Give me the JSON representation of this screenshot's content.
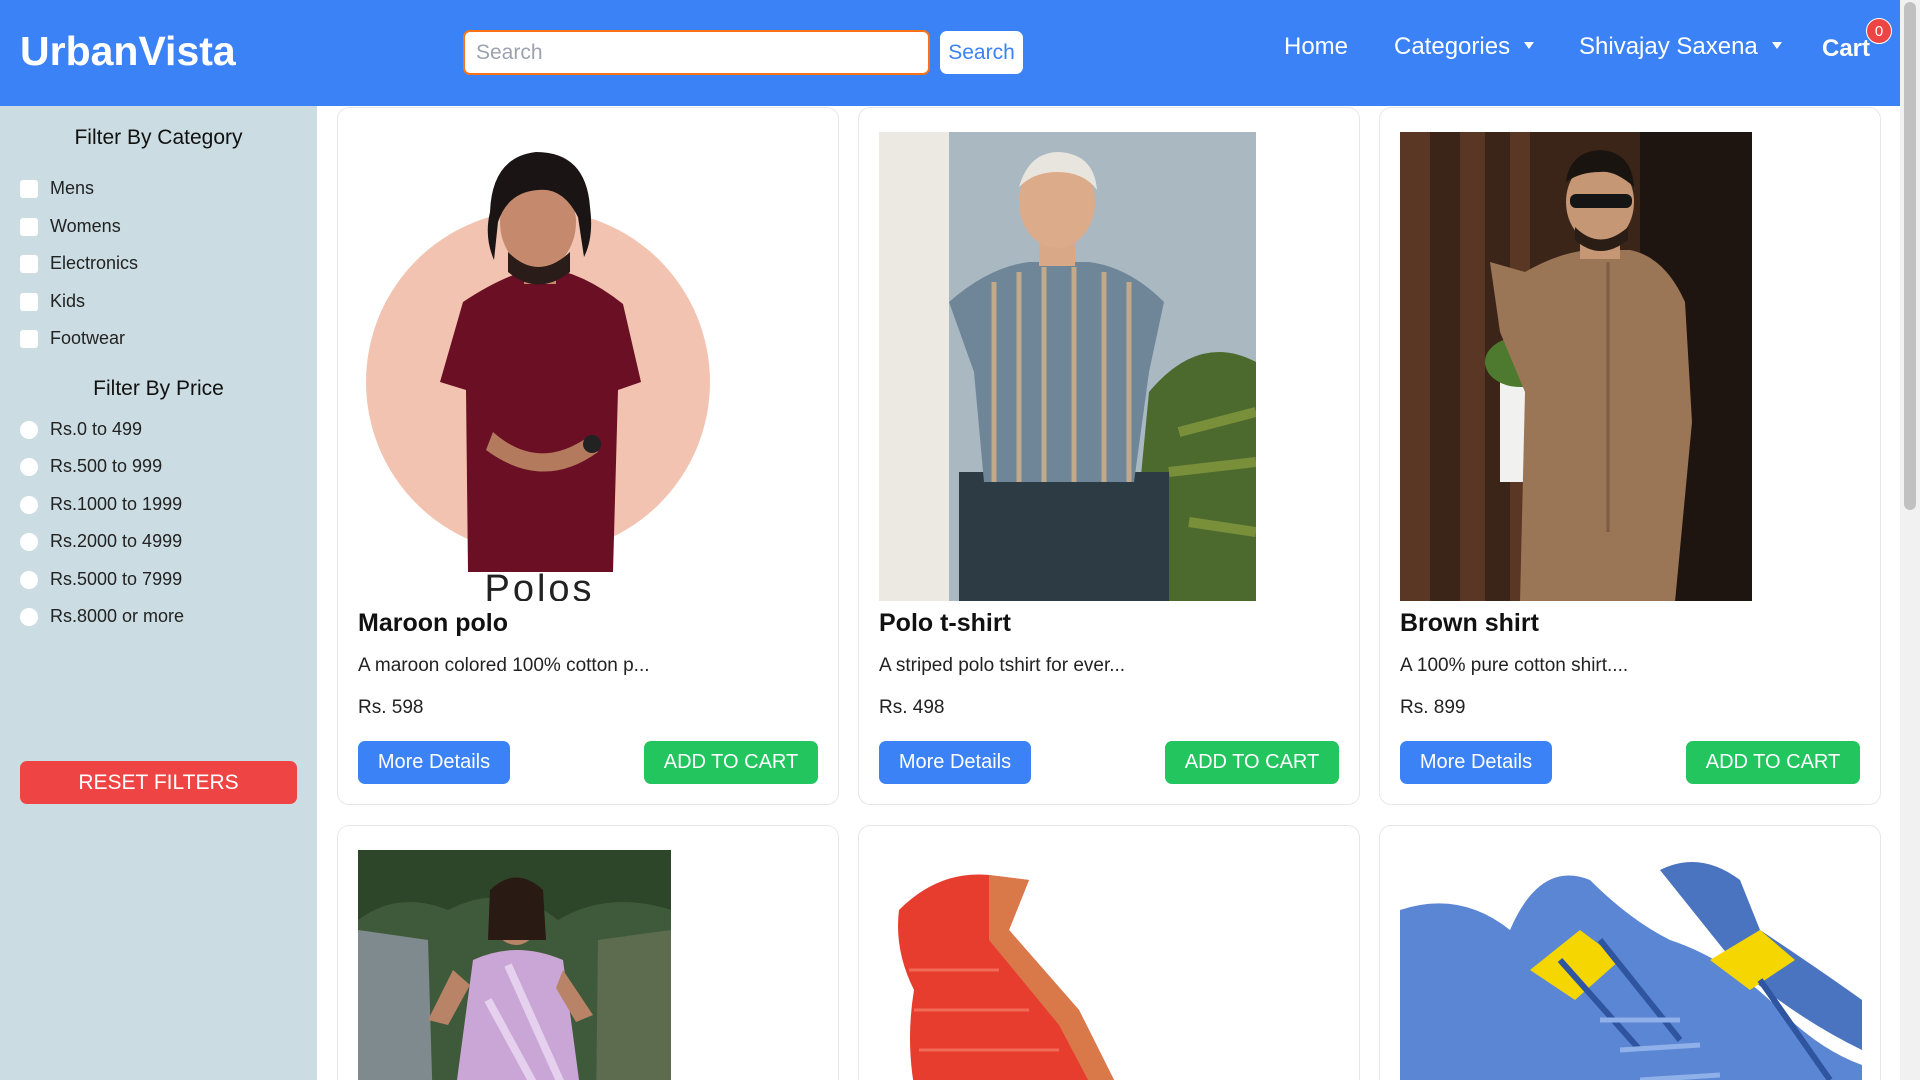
{
  "header": {
    "logo": "UrbanVista",
    "search_placeholder": "Search",
    "search_button": "Search",
    "nav": {
      "home": "Home",
      "categories": "Categories",
      "user": "Shivajay Saxena",
      "cart": "Cart"
    },
    "cart_count": "0"
  },
  "sidebar": {
    "category_title": "Filter By Category",
    "categories": [
      "Mens",
      "Womens",
      "Electronics",
      "Kids",
      "Footwear"
    ],
    "price_title": "Filter By Price",
    "prices": [
      "Rs.0 to 499",
      "Rs.500 to 999",
      "Rs.1000 to 1999",
      "Rs.2000 to 4999",
      "Rs.5000 to 7999",
      "Rs.8000 or more"
    ],
    "reset_button": "RESET FILTERS"
  },
  "products": [
    {
      "name": "Maroon polo",
      "desc": "A maroon colored 100% cotton p...",
      "price": "Rs. 598",
      "image_caption": "Polos",
      "image": "man-maroon-polo-photo"
    },
    {
      "name": "Polo t-shirt",
      "desc": "A striped polo tshirt for ever...",
      "price": "Rs. 498",
      "image": "man-striped-polo-photo"
    },
    {
      "name": "Brown shirt",
      "desc": "A 100% pure cotton shirt....",
      "price": "Rs. 899",
      "image": "man-brown-shirt-photo"
    },
    {
      "image": "woman-lilac-saree-photo"
    },
    {
      "image": "red-saree-photo"
    },
    {
      "image": "blue-sneakers-photo"
    }
  ],
  "buttons": {
    "more_details": "More Details",
    "add_to_cart": "ADD TO CART"
  },
  "colors": {
    "brand": "#3b82f6",
    "danger": "#ef4444",
    "success": "#22c55e",
    "sidebar": "#cbdde3"
  }
}
